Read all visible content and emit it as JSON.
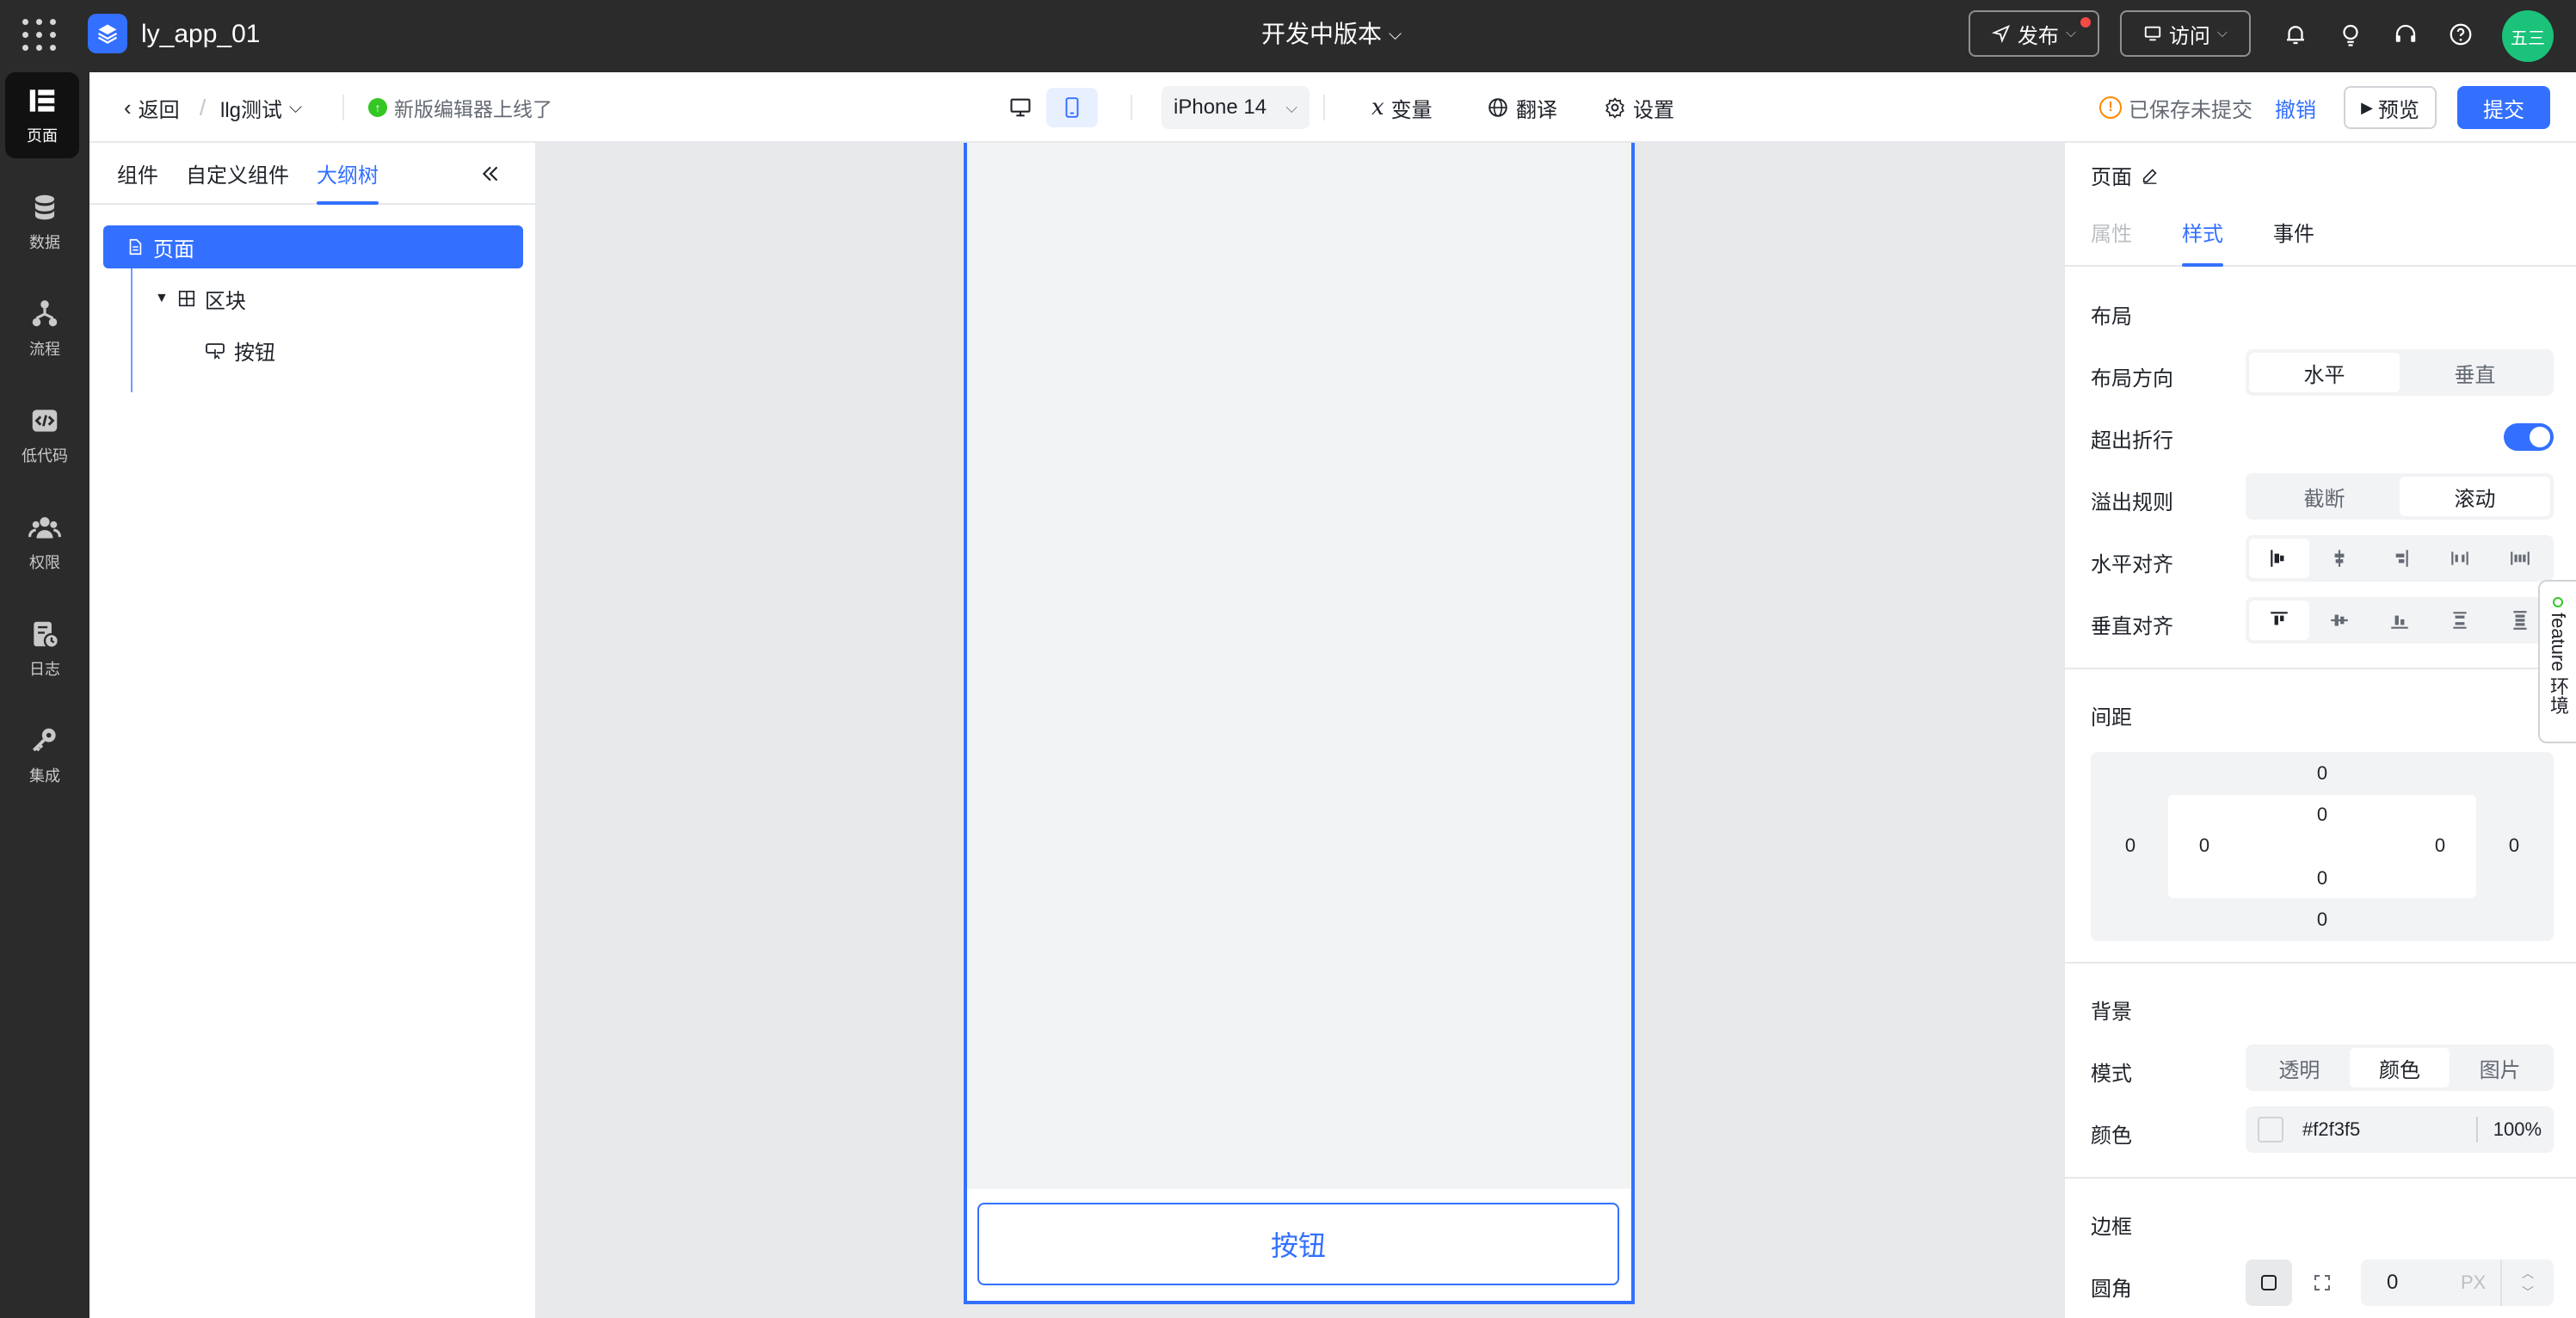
{
  "topbar": {
    "app_name": "ly_app_01",
    "version_label": "开发中版本",
    "publish_label": "发布",
    "visit_label": "访问",
    "avatar_text": "五三"
  },
  "rail": {
    "items": [
      {
        "label": "页面",
        "icon": "page-icon"
      },
      {
        "label": "数据",
        "icon": "database-icon"
      },
      {
        "label": "流程",
        "icon": "flow-icon"
      },
      {
        "label": "低代码",
        "icon": "code-icon"
      },
      {
        "label": "权限",
        "icon": "users-icon"
      },
      {
        "label": "日志",
        "icon": "log-icon"
      },
      {
        "label": "集成",
        "icon": "key-icon"
      }
    ]
  },
  "subbar": {
    "back_label": "返回",
    "separator": "/",
    "project_name": "llg测试",
    "notice": "新版编辑器上线了",
    "device": "iPhone 14",
    "variables_label": "变量",
    "translate_label": "翻译",
    "settings_label": "设置",
    "save_status": "已保存未提交",
    "undo_label": "撤销",
    "preview_label": "预览",
    "submit_label": "提交"
  },
  "left_panel": {
    "tabs": [
      "组件",
      "自定义组件",
      "大纲树"
    ],
    "tree": {
      "page": "页面",
      "block": "区块",
      "button": "按钮"
    }
  },
  "canvas": {
    "button_label": "按钮"
  },
  "right_panel": {
    "title": "页面",
    "tabs": [
      "属性",
      "样式",
      "事件"
    ],
    "layout": {
      "section": "布局",
      "direction_label": "布局方向",
      "direction_options": [
        "水平",
        "垂直"
      ],
      "wrap_label": "超出折行",
      "overflow_label": "溢出规则",
      "overflow_options": [
        "截断",
        "滚动"
      ],
      "h_align_label": "水平对齐",
      "v_align_label": "垂直对齐"
    },
    "spacing": {
      "section": "间距",
      "margin_top": "0",
      "margin_left": "0",
      "margin_right": "0",
      "margin_bottom": "0",
      "padding_top": "0",
      "padding_left": "0",
      "padding_right": "0",
      "padding_bottom": "0"
    },
    "background": {
      "section": "背景",
      "mode_label": "模式",
      "mode_options": [
        "透明",
        "颜色",
        "图片"
      ],
      "color_label": "颜色",
      "color_value": "#f2f3f5",
      "opacity": "100",
      "opacity_unit": "%"
    },
    "border": {
      "section": "边框",
      "radius_label": "圆角",
      "radius_value": "0",
      "unit": "PX"
    }
  },
  "feature_tab": "feature 环境",
  "colors": {
    "primary": "#3370ff",
    "topbar_bg": "#2b2b2b",
    "avatar": "#1bc27a"
  }
}
